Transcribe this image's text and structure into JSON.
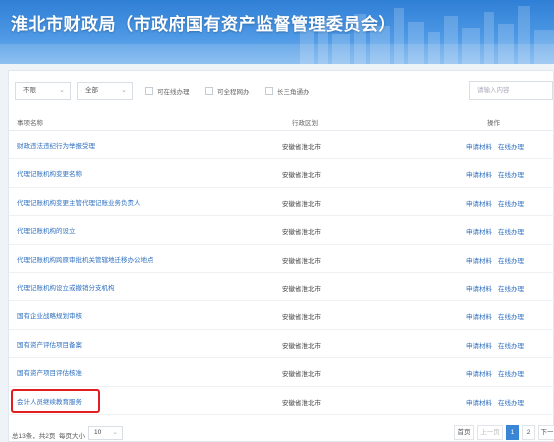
{
  "header": {
    "title": "淮北市财政局（市政府国有资产监督管理委员会）"
  },
  "filters": {
    "scope": "不限",
    "type": "全部",
    "checkboxes": [
      "可在线办理",
      "可全程网办",
      "长三角通办"
    ],
    "search_placeholder": "请输入内容"
  },
  "table": {
    "columns": [
      "事项名称",
      "行政区划",
      "操作"
    ],
    "rows": [
      {
        "name": "财政违法违纪行为举报受理",
        "region": "安徽省淮北市",
        "apply": "申请材料",
        "online": "在线办理"
      },
      {
        "name": "代理记账机构变更名称",
        "region": "安徽省淮北市",
        "apply": "申请材料",
        "online": "在线办理"
      },
      {
        "name": "代理记账机构变更主管代理记账业务负责人",
        "region": "安徽省淮北市",
        "apply": "申请材料",
        "online": "在线办理"
      },
      {
        "name": "代理记账机构的设立",
        "region": "安徽省淮北市",
        "apply": "申请材料",
        "online": "在线办理"
      },
      {
        "name": "代理记账机构跨原审批机关管辖地迁移办公地点",
        "region": "安徽省淮北市",
        "apply": "申请材料",
        "online": "在线办理"
      },
      {
        "name": "代理记账机构设立或撤销分支机构",
        "region": "安徽省淮北市",
        "apply": "申请材料",
        "online": "在线办理"
      },
      {
        "name": "国有企业战略规划审核",
        "region": "安徽省淮北市",
        "apply": "申请材料",
        "online": "在线办理"
      },
      {
        "name": "国有资产评估项目备案",
        "region": "安徽省淮北市",
        "apply": "申请材料",
        "online": "在线办理"
      },
      {
        "name": "国有资产项目评估核准",
        "region": "安徽省淮北市",
        "apply": "申请材料",
        "online": "在线办理"
      },
      {
        "name": "会计人员继续教育服务",
        "region": "安徽省淮北市",
        "apply": "申请材料",
        "online": "在线办理"
      }
    ]
  },
  "pagination": {
    "summary": "总13条，共2页",
    "page_size_label": "每页大小",
    "page_size": "10",
    "first": "首页",
    "prev": "上一页",
    "pages": [
      "1",
      "2"
    ],
    "next": "下一"
  },
  "colors": {
    "accent": "#3a86d6",
    "link": "#2e6fbf",
    "highlight": "#e02020",
    "banner": "#2f7fd6"
  }
}
